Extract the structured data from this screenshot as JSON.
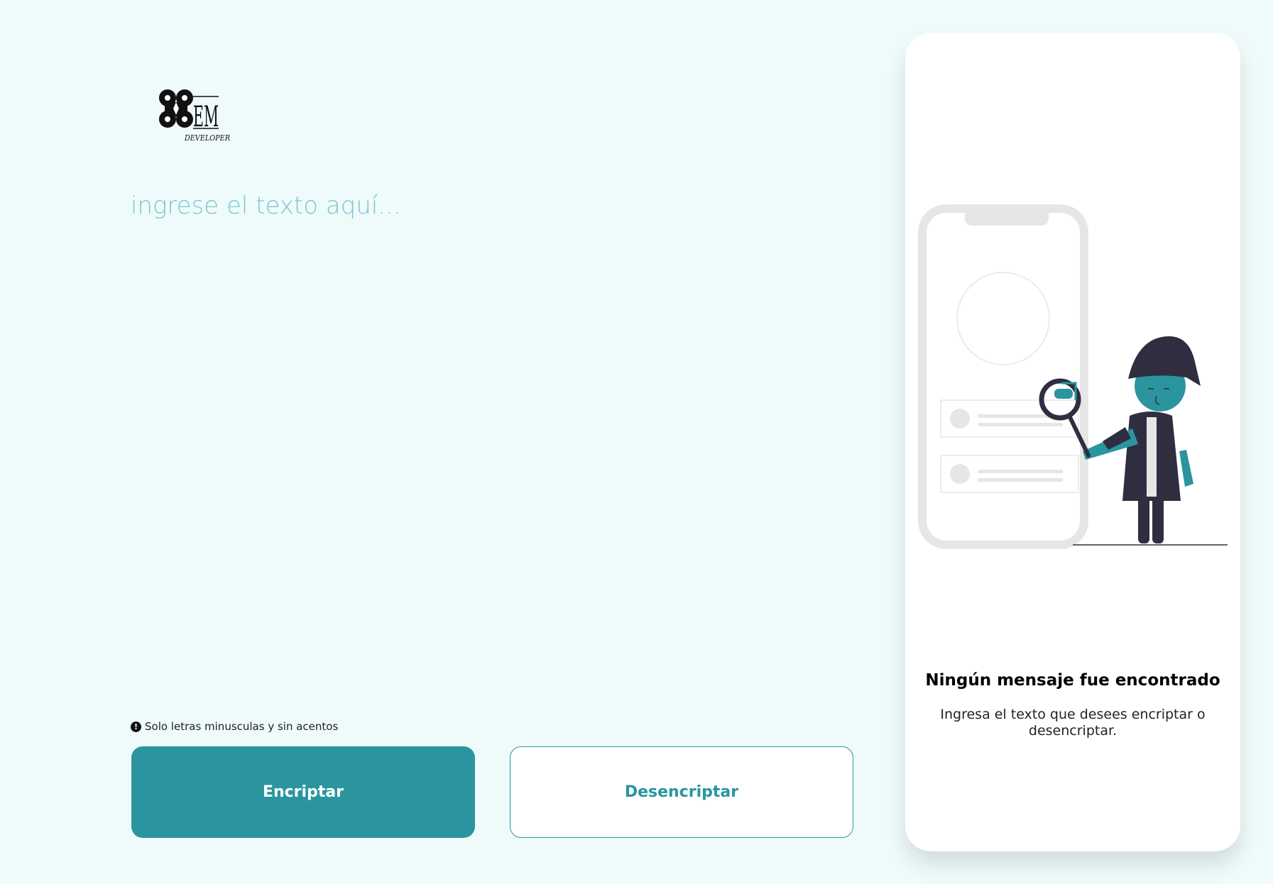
{
  "logo": {
    "text": "EM",
    "subtext": "DEVELOPER"
  },
  "input": {
    "value": "",
    "placeholder": "ingrese el texto aquí..."
  },
  "hint": {
    "icon": "!",
    "text": "Solo letras minusculas y sin acentos"
  },
  "buttons": {
    "encrypt_label": "Encriptar",
    "decrypt_label": "Desencriptar"
  },
  "output": {
    "title": "Ningún mensaje fue encontrado",
    "description": "Ingresa el texto que desees encriptar o desencriptar."
  },
  "colors": {
    "background": "#effbfb",
    "accent": "#2a959f",
    "placeholder": "#7cc6cc",
    "card": "#ffffff"
  }
}
